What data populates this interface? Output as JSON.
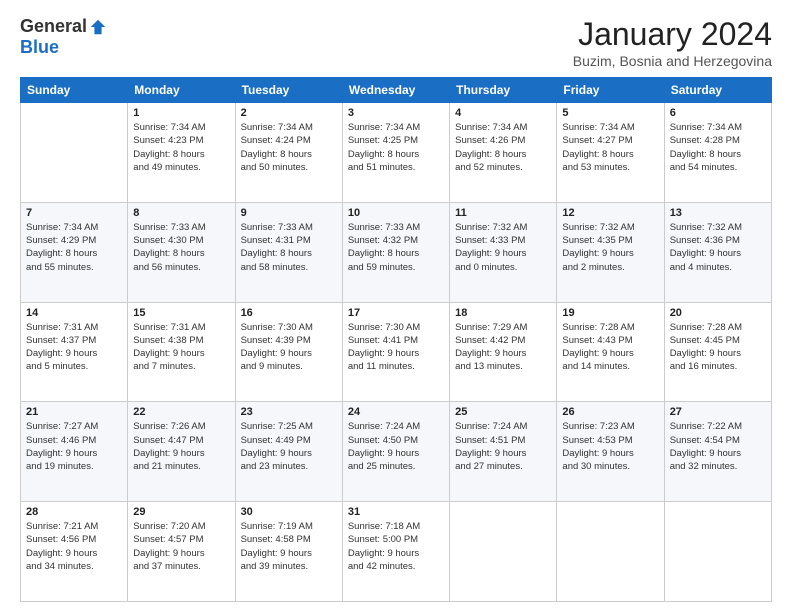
{
  "logo": {
    "general": "General",
    "blue": "Blue"
  },
  "title": "January 2024",
  "location": "Buzim, Bosnia and Herzegovina",
  "days_of_week": [
    "Sunday",
    "Monday",
    "Tuesday",
    "Wednesday",
    "Thursday",
    "Friday",
    "Saturday"
  ],
  "weeks": [
    [
      {
        "day": "",
        "info": ""
      },
      {
        "day": "1",
        "info": "Sunrise: 7:34 AM\nSunset: 4:23 PM\nDaylight: 8 hours\nand 49 minutes."
      },
      {
        "day": "2",
        "info": "Sunrise: 7:34 AM\nSunset: 4:24 PM\nDaylight: 8 hours\nand 50 minutes."
      },
      {
        "day": "3",
        "info": "Sunrise: 7:34 AM\nSunset: 4:25 PM\nDaylight: 8 hours\nand 51 minutes."
      },
      {
        "day": "4",
        "info": "Sunrise: 7:34 AM\nSunset: 4:26 PM\nDaylight: 8 hours\nand 52 minutes."
      },
      {
        "day": "5",
        "info": "Sunrise: 7:34 AM\nSunset: 4:27 PM\nDaylight: 8 hours\nand 53 minutes."
      },
      {
        "day": "6",
        "info": "Sunrise: 7:34 AM\nSunset: 4:28 PM\nDaylight: 8 hours\nand 54 minutes."
      }
    ],
    [
      {
        "day": "7",
        "info": "Sunrise: 7:34 AM\nSunset: 4:29 PM\nDaylight: 8 hours\nand 55 minutes."
      },
      {
        "day": "8",
        "info": "Sunrise: 7:33 AM\nSunset: 4:30 PM\nDaylight: 8 hours\nand 56 minutes."
      },
      {
        "day": "9",
        "info": "Sunrise: 7:33 AM\nSunset: 4:31 PM\nDaylight: 8 hours\nand 58 minutes."
      },
      {
        "day": "10",
        "info": "Sunrise: 7:33 AM\nSunset: 4:32 PM\nDaylight: 8 hours\nand 59 minutes."
      },
      {
        "day": "11",
        "info": "Sunrise: 7:32 AM\nSunset: 4:33 PM\nDaylight: 9 hours\nand 0 minutes."
      },
      {
        "day": "12",
        "info": "Sunrise: 7:32 AM\nSunset: 4:35 PM\nDaylight: 9 hours\nand 2 minutes."
      },
      {
        "day": "13",
        "info": "Sunrise: 7:32 AM\nSunset: 4:36 PM\nDaylight: 9 hours\nand 4 minutes."
      }
    ],
    [
      {
        "day": "14",
        "info": "Sunrise: 7:31 AM\nSunset: 4:37 PM\nDaylight: 9 hours\nand 5 minutes."
      },
      {
        "day": "15",
        "info": "Sunrise: 7:31 AM\nSunset: 4:38 PM\nDaylight: 9 hours\nand 7 minutes."
      },
      {
        "day": "16",
        "info": "Sunrise: 7:30 AM\nSunset: 4:39 PM\nDaylight: 9 hours\nand 9 minutes."
      },
      {
        "day": "17",
        "info": "Sunrise: 7:30 AM\nSunset: 4:41 PM\nDaylight: 9 hours\nand 11 minutes."
      },
      {
        "day": "18",
        "info": "Sunrise: 7:29 AM\nSunset: 4:42 PM\nDaylight: 9 hours\nand 13 minutes."
      },
      {
        "day": "19",
        "info": "Sunrise: 7:28 AM\nSunset: 4:43 PM\nDaylight: 9 hours\nand 14 minutes."
      },
      {
        "day": "20",
        "info": "Sunrise: 7:28 AM\nSunset: 4:45 PM\nDaylight: 9 hours\nand 16 minutes."
      }
    ],
    [
      {
        "day": "21",
        "info": "Sunrise: 7:27 AM\nSunset: 4:46 PM\nDaylight: 9 hours\nand 19 minutes."
      },
      {
        "day": "22",
        "info": "Sunrise: 7:26 AM\nSunset: 4:47 PM\nDaylight: 9 hours\nand 21 minutes."
      },
      {
        "day": "23",
        "info": "Sunrise: 7:25 AM\nSunset: 4:49 PM\nDaylight: 9 hours\nand 23 minutes."
      },
      {
        "day": "24",
        "info": "Sunrise: 7:24 AM\nSunset: 4:50 PM\nDaylight: 9 hours\nand 25 minutes."
      },
      {
        "day": "25",
        "info": "Sunrise: 7:24 AM\nSunset: 4:51 PM\nDaylight: 9 hours\nand 27 minutes."
      },
      {
        "day": "26",
        "info": "Sunrise: 7:23 AM\nSunset: 4:53 PM\nDaylight: 9 hours\nand 30 minutes."
      },
      {
        "day": "27",
        "info": "Sunrise: 7:22 AM\nSunset: 4:54 PM\nDaylight: 9 hours\nand 32 minutes."
      }
    ],
    [
      {
        "day": "28",
        "info": "Sunrise: 7:21 AM\nSunset: 4:56 PM\nDaylight: 9 hours\nand 34 minutes."
      },
      {
        "day": "29",
        "info": "Sunrise: 7:20 AM\nSunset: 4:57 PM\nDaylight: 9 hours\nand 37 minutes."
      },
      {
        "day": "30",
        "info": "Sunrise: 7:19 AM\nSunset: 4:58 PM\nDaylight: 9 hours\nand 39 minutes."
      },
      {
        "day": "31",
        "info": "Sunrise: 7:18 AM\nSunset: 5:00 PM\nDaylight: 9 hours\nand 42 minutes."
      },
      {
        "day": "",
        "info": ""
      },
      {
        "day": "",
        "info": ""
      },
      {
        "day": "",
        "info": ""
      }
    ]
  ]
}
